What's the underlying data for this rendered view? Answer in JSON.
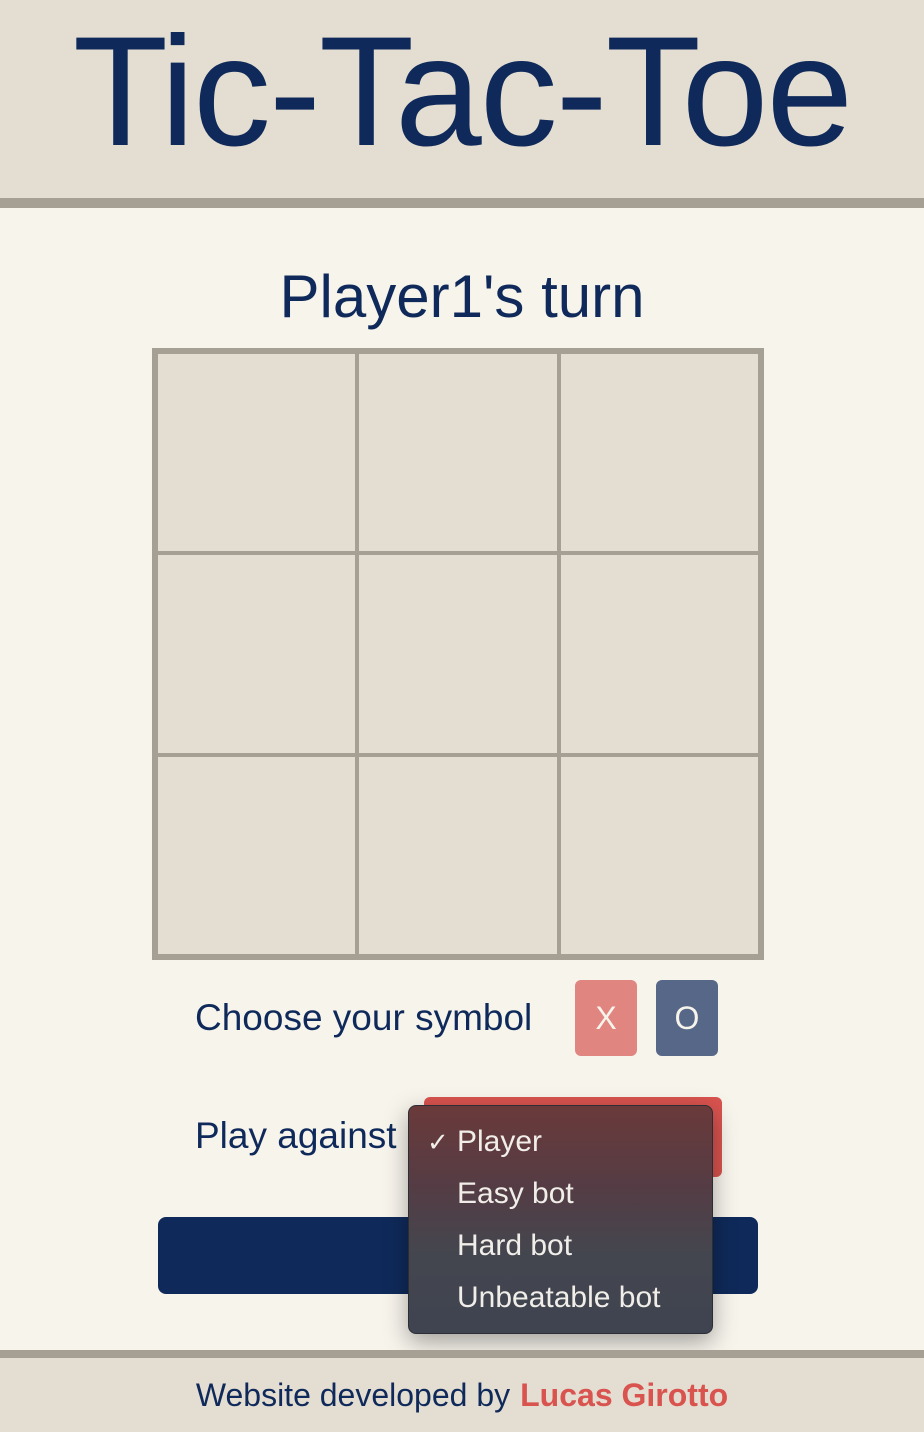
{
  "header": {
    "title": "Tic-Tac-Toe"
  },
  "game": {
    "turn_text": "Player1's turn",
    "board": [
      "",
      "",
      "",
      "",
      "",
      "",
      "",
      "",
      ""
    ]
  },
  "controls": {
    "symbol_label": "Choose your symbol",
    "symbol_x": "X",
    "symbol_o": "O",
    "opponent_label": "Play against",
    "opponent_options": [
      {
        "label": "Player",
        "selected": true
      },
      {
        "label": "Easy bot",
        "selected": false
      },
      {
        "label": "Hard bot",
        "selected": false
      },
      {
        "label": "Unbeatable bot",
        "selected": false
      }
    ],
    "check_glyph": "✓"
  },
  "footer": {
    "text": "Website developed by",
    "author": "Lucas Girotto"
  },
  "colors": {
    "navy": "#0f2a5a",
    "red": "#d9534f",
    "x_button": "#e0857f",
    "o_button": "#566788",
    "board_bg": "#e4ddd1",
    "board_border": "#a69f93",
    "page_bg": "#f7f4ec"
  }
}
